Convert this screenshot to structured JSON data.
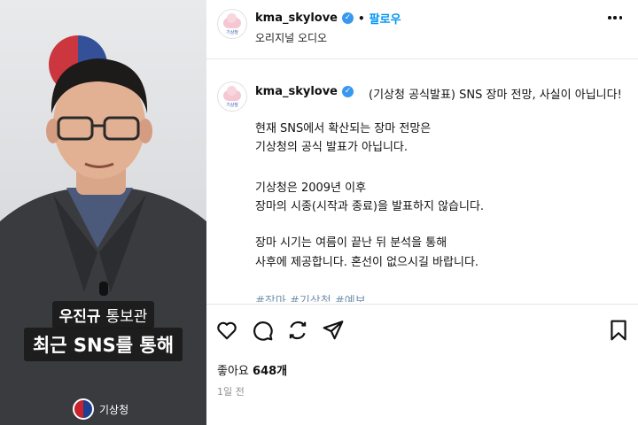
{
  "video": {
    "caption_name": "우진규",
    "caption_title": "통보관",
    "caption_line": "최근 SNS를 통해",
    "watermark": "기상청"
  },
  "header": {
    "username": "kma_skylove",
    "dot": "•",
    "follow_label": "팔로우",
    "subtitle": "오리지널 오디오",
    "avatar_text": "기상청"
  },
  "post": {
    "username": "kma_skylove",
    "headline": "(기상청 공식발표) SNS 장마 전망, 사실이 아닙니다!",
    "paragraph1": [
      "현재 SNS에서 확산되는 장마 전망은",
      "기상청의 공식 발표가 아닙니다."
    ],
    "paragraph2": [
      "기상청은 2009년 이후",
      "장마의 시종(시작과 종료)을 발표하지 않습니다."
    ],
    "paragraph3": [
      "장마 시기는 여름이 끝난 뒤 분석을 통해",
      "사후에 제공합니다. 혼선이 없으시길 바랍니다."
    ],
    "hashtags": "#장마 #기상청 #예보"
  },
  "actions": {
    "icons": [
      "heart-icon",
      "comment-icon",
      "repost-icon",
      "share-icon",
      "bookmark-icon"
    ]
  },
  "stats": {
    "likes_label": "좋아요",
    "likes_count": "648개",
    "timestamp": "1일 전"
  },
  "colors": {
    "follow": "#0095f6",
    "verified": "#3897f0"
  }
}
